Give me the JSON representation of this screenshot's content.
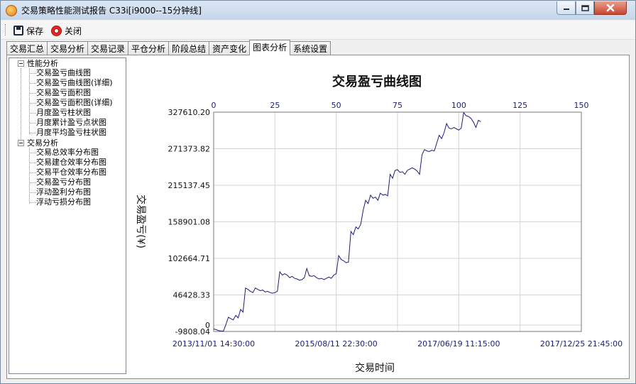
{
  "window": {
    "title": "交易策略性能测试报告 C33i[i9000--15分钟线]"
  },
  "toolbar": {
    "save_label": "保存",
    "close_label": "关闭"
  },
  "tabs": [
    {
      "label": "交易汇总",
      "active": false
    },
    {
      "label": "交易分析",
      "active": false
    },
    {
      "label": "交易记录",
      "active": false
    },
    {
      "label": "平仓分析",
      "active": false
    },
    {
      "label": "阶段总结",
      "active": false
    },
    {
      "label": "资产变化",
      "active": false
    },
    {
      "label": "图表分析",
      "active": true
    },
    {
      "label": "系统设置",
      "active": false
    }
  ],
  "tree": {
    "groups": [
      {
        "label": "性能分析",
        "items": [
          "交易盈亏曲线图",
          "交易盈亏曲线图(详细)",
          "交易盈亏面积图",
          "交易盈亏面积图(详细)",
          "月度盈亏柱状图",
          "月度累计盈亏点状图",
          "月度平均盈亏柱状图"
        ]
      },
      {
        "label": "交易分析",
        "items": [
          "交易总效率分布图",
          "交易建仓效率分布图",
          "交易平仓效率分布图",
          "交易盈亏分布图",
          "浮动盈利分布图",
          "浮动亏损分布图"
        ]
      }
    ]
  },
  "chart_data": {
    "type": "line",
    "title": "交易盈亏曲线图",
    "xlabel": "交易时间",
    "ylabel": "交易盈亏(¥)",
    "grid": true,
    "line_color": "#1c1c7a",
    "axis_label_color": "#1c1c7a",
    "y_ticks": [
      "327610.20",
      "271373.82",
      "215137.45",
      "158901.08",
      "102664.71",
      "46428.33",
      "0",
      "-9808.04"
    ],
    "y_range": [
      -9808.04,
      327610.2
    ],
    "top_x_ticks": [
      "0",
      "25",
      "50",
      "75",
      "100",
      "125",
      "150"
    ],
    "top_x_range": [
      0,
      150
    ],
    "bottom_x_ticks": [
      "2013/11/01 14:30:00",
      "2015/08/11 22:30:00",
      "2017/06/19 11:15:00",
      "2017/12/25 21:45:00"
    ],
    "series": [
      {
        "values": [
          [
            0,
            -6000
          ],
          [
            1,
            -7000
          ],
          [
            2,
            -8500
          ],
          [
            3,
            -9000
          ],
          [
            4,
            -9300
          ],
          [
            5,
            1000
          ],
          [
            6,
            12000
          ],
          [
            7,
            10000
          ],
          [
            8,
            8000
          ],
          [
            9,
            15000
          ],
          [
            10,
            11000
          ],
          [
            11,
            24000
          ],
          [
            12,
            20000
          ],
          [
            13,
            57000
          ],
          [
            14,
            55000
          ],
          [
            15,
            52000
          ],
          [
            16,
            50000
          ],
          [
            17,
            57000
          ],
          [
            18,
            55000
          ],
          [
            19,
            53000
          ],
          [
            20,
            54000
          ],
          [
            21,
            51000
          ],
          [
            22,
            52000
          ],
          [
            23,
            50000
          ],
          [
            24,
            49000
          ],
          [
            25,
            50000
          ],
          [
            26,
            52000
          ],
          [
            27,
            82000
          ],
          [
            28,
            77000
          ],
          [
            29,
            79000
          ],
          [
            30,
            77000
          ],
          [
            31,
            73000
          ],
          [
            32,
            75000
          ],
          [
            33,
            72000
          ],
          [
            34,
            71000
          ],
          [
            35,
            69000
          ],
          [
            36,
            70000
          ],
          [
            37,
            73000
          ],
          [
            38,
            87000
          ],
          [
            39,
            76000
          ],
          [
            40,
            75000
          ],
          [
            41,
            76000
          ],
          [
            42,
            73000
          ],
          [
            43,
            71000
          ],
          [
            44,
            72000
          ],
          [
            45,
            70000
          ],
          [
            46,
            72000
          ],
          [
            47,
            74000
          ],
          [
            48,
            72000
          ],
          [
            49,
            77000
          ],
          [
            50,
            79000
          ],
          [
            51,
            107000
          ],
          [
            52,
            101000
          ],
          [
            53,
            99000
          ],
          [
            54,
            96000
          ],
          [
            55,
            97000
          ],
          [
            56,
            144000
          ],
          [
            57,
            139000
          ],
          [
            58,
            151000
          ],
          [
            59,
            148000
          ],
          [
            60,
            155000
          ],
          [
            61,
            177000
          ],
          [
            62,
            192000
          ],
          [
            63,
            187000
          ],
          [
            64,
            200000
          ],
          [
            65,
            195000
          ],
          [
            66,
            197000
          ],
          [
            67,
            192000
          ],
          [
            68,
            203000
          ],
          [
            69,
            200000
          ],
          [
            70,
            201000
          ],
          [
            71,
            199000
          ],
          [
            72,
            232000
          ],
          [
            73,
            226000
          ],
          [
            74,
            238000
          ],
          [
            75,
            239000
          ],
          [
            76,
            235000
          ],
          [
            77,
            236000
          ],
          [
            78,
            232000
          ],
          [
            79,
            238000
          ],
          [
            80,
            240000
          ],
          [
            81,
            242000
          ],
          [
            82,
            240000
          ],
          [
            83,
            237000
          ],
          [
            84,
            232000
          ],
          [
            85,
            262000
          ],
          [
            86,
            270000
          ],
          [
            87,
            268000
          ],
          [
            88,
            267000
          ],
          [
            89,
            269000
          ],
          [
            90,
            268000
          ],
          [
            91,
            280000
          ],
          [
            92,
            292000
          ],
          [
            93,
            287000
          ],
          [
            94,
            296000
          ],
          [
            95,
            310000
          ],
          [
            96,
            303000
          ],
          [
            97,
            302000
          ],
          [
            98,
            304000
          ],
          [
            99,
            302000
          ],
          [
            100,
            300000
          ],
          [
            101,
            303000
          ],
          [
            102,
            327000
          ],
          [
            103,
            322000
          ],
          [
            104,
            321000
          ],
          [
            105,
            318000
          ],
          [
            106,
            312000
          ],
          [
            107,
            304000
          ],
          [
            108,
            315000
          ],
          [
            109,
            313000
          ]
        ]
      }
    ]
  }
}
